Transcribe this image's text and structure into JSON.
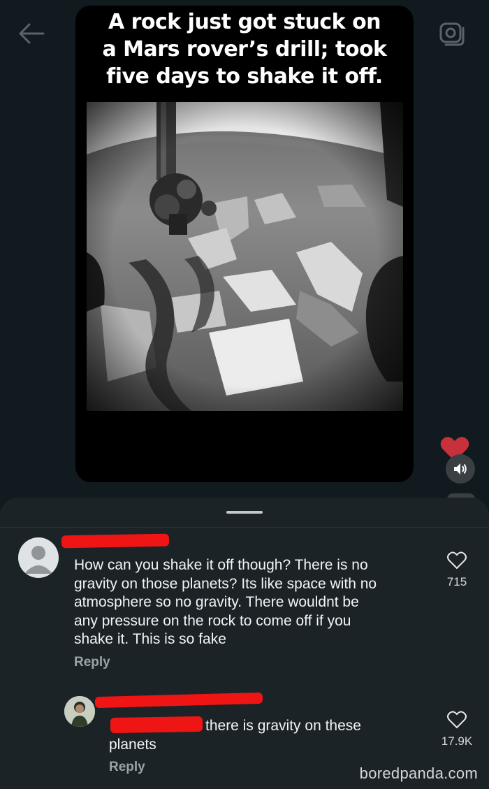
{
  "reel": {
    "caption": "A rock just got stuck on\na Mars rover’s drill; took\nfive days to shake it off."
  },
  "topbar": {
    "back_icon": "arrow-left-icon",
    "camera_icon": "camera-icon"
  },
  "side_actions": {
    "like_icon": "heart-icon",
    "like_color": "#e0353b",
    "volume_icon": "speaker-icon"
  },
  "comments": [
    {
      "text": "How can you shake it off though? There is no\ngravity on those planets? Its like space with no\natmosphere so no gravity. There wouldnt be\nany pressure on the rock to come off if you\nshake it. This is so fake",
      "reply_label": "Reply",
      "likes": "715"
    },
    {
      "text_visible": "there is gravity on these",
      "text_cont": "planets",
      "reply_label": "Reply",
      "likes": "17.9K"
    }
  ],
  "watermark": "boredpanda.com",
  "colors": {
    "background": "#111a1f",
    "sheet": "#1c2327",
    "redaction": "#f01515"
  }
}
